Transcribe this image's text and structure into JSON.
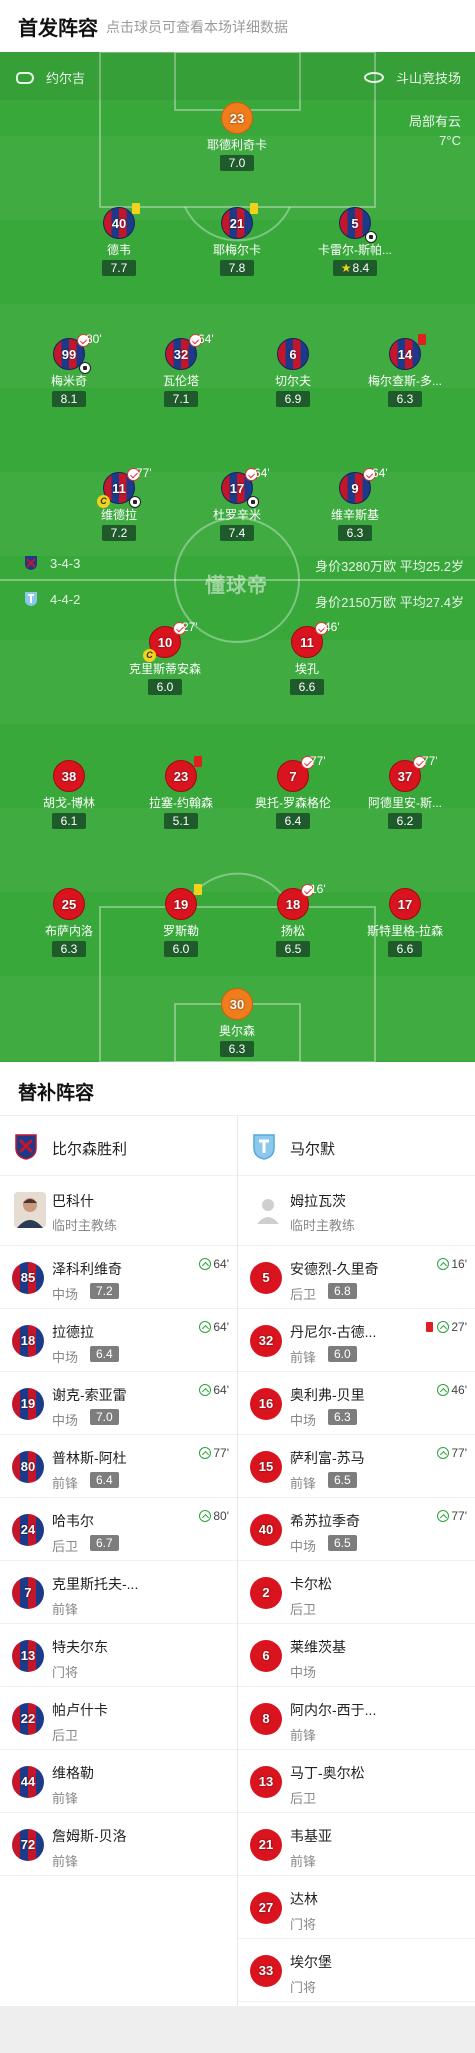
{
  "header": {
    "title": "首发阵容",
    "subtitle": "点击球员可查看本场详细数据"
  },
  "pitch": {
    "home_team_top": "约尔吉",
    "venue": "斗山竞技场",
    "weather": "局部有云",
    "temperature": "7°C",
    "watermark": "懂球帝",
    "home_formation": {
      "formation": "3-4-3",
      "stats": "身价3280万欧 平均25.2岁"
    },
    "away_formation": {
      "formation": "4-4-2",
      "stats": "身价2150万欧 平均27.4岁"
    },
    "players": [
      {
        "id": "p1",
        "num": "23",
        "name": "耶德利奇卡",
        "rating": "7.0",
        "kit": "gk"
      },
      {
        "id": "p2",
        "num": "40",
        "name": "德韦",
        "rating": "7.7",
        "kit": "home",
        "card": "yellow"
      },
      {
        "id": "p3",
        "num": "21",
        "name": "耶梅尔卡",
        "rating": "7.8",
        "kit": "home",
        "card": "yellow"
      },
      {
        "id": "p4",
        "num": "5",
        "name": "卡雷尔-斯帕...",
        "rating": "8.4",
        "kit": "home",
        "ball": true,
        "star": true
      },
      {
        "id": "p5",
        "num": "99",
        "name": "梅米奇",
        "rating": "8.1",
        "kit": "home",
        "sub": "80'",
        "ball": true
      },
      {
        "id": "p6",
        "num": "32",
        "name": "瓦伦塔",
        "rating": "7.1",
        "kit": "home",
        "sub": "64'"
      },
      {
        "id": "p7",
        "num": "6",
        "name": "切尔夫",
        "rating": "6.9",
        "kit": "home"
      },
      {
        "id": "p8",
        "num": "14",
        "name": "梅尔查斯-多...",
        "rating": "6.3",
        "kit": "home",
        "card": "red"
      },
      {
        "id": "p9",
        "num": "11",
        "name": "维德拉",
        "rating": "7.2",
        "kit": "home",
        "sub": "77'",
        "ball": true,
        "captain": true
      },
      {
        "id": "p10",
        "num": "17",
        "name": "杜罗辛米",
        "rating": "7.4",
        "kit": "home",
        "sub": "64'",
        "ball": true
      },
      {
        "id": "p11",
        "num": "9",
        "name": "维辛斯基",
        "rating": "6.3",
        "kit": "home",
        "sub": "64'"
      },
      {
        "id": "p12",
        "num": "10",
        "name": "克里斯蒂安森",
        "rating": "6.0",
        "kit": "away",
        "sub": "27'",
        "card": "yellow",
        "captain": true
      },
      {
        "id": "p13",
        "num": "11",
        "name": "埃孔",
        "rating": "6.6",
        "kit": "away",
        "sub": "46'"
      },
      {
        "id": "p14",
        "num": "38",
        "name": "胡戈-博林",
        "rating": "6.1",
        "kit": "away"
      },
      {
        "id": "p15",
        "num": "23",
        "name": "拉塞-约翰森",
        "rating": "5.1",
        "kit": "away",
        "card": "red"
      },
      {
        "id": "p16",
        "num": "7",
        "name": "奥托-罗森格伦",
        "rating": "6.4",
        "kit": "away",
        "sub": "77'"
      },
      {
        "id": "p17",
        "num": "37",
        "name": "阿德里安-斯...",
        "rating": "6.2",
        "kit": "away",
        "sub": "77'"
      },
      {
        "id": "p18",
        "num": "25",
        "name": "布萨内洛",
        "rating": "6.3",
        "kit": "away"
      },
      {
        "id": "p19",
        "num": "19",
        "name": "罗斯勒",
        "rating": "6.0",
        "kit": "away",
        "card": "yellow"
      },
      {
        "id": "p20",
        "num": "18",
        "name": "扬松",
        "rating": "6.5",
        "kit": "away",
        "sub": "16'"
      },
      {
        "id": "p21",
        "num": "17",
        "name": "斯特里格-拉森",
        "rating": "6.6",
        "kit": "away"
      },
      {
        "id": "p22",
        "num": "30",
        "name": "奥尔森",
        "rating": "6.3",
        "kit": "gk"
      }
    ]
  },
  "subs": {
    "title": "替补阵容",
    "home": {
      "team": "比尔森胜利",
      "coach": {
        "name": "巴科什",
        "role": "临时主教练"
      },
      "players": [
        {
          "num": "85",
          "name": "泽科利维奇",
          "pos": "中场",
          "rating": "7.2",
          "in": "64'"
        },
        {
          "num": "18",
          "name": "拉德拉",
          "pos": "中场",
          "rating": "6.4",
          "in": "64'"
        },
        {
          "num": "19",
          "name": "谢克-索亚雷",
          "pos": "中场",
          "rating": "7.0",
          "in": "64'"
        },
        {
          "num": "80",
          "name": "普林斯-阿杜",
          "pos": "前锋",
          "rating": "6.4",
          "in": "77'"
        },
        {
          "num": "24",
          "name": "哈韦尔",
          "pos": "后卫",
          "rating": "6.7",
          "in": "80'"
        },
        {
          "num": "7",
          "name": "克里斯托夫-...",
          "pos": "前锋"
        },
        {
          "num": "13",
          "name": "特夫尔东",
          "pos": "门将"
        },
        {
          "num": "22",
          "name": "帕卢什卡",
          "pos": "后卫"
        },
        {
          "num": "44",
          "name": "维格勒",
          "pos": "前锋"
        },
        {
          "num": "72",
          "name": "詹姆斯-贝洛",
          "pos": "前锋"
        }
      ]
    },
    "away": {
      "team": "马尔默",
      "coach": {
        "name": "姆拉瓦茨",
        "role": "临时主教练"
      },
      "players": [
        {
          "num": "5",
          "name": "安德烈-久里奇",
          "pos": "后卫",
          "rating": "6.8",
          "in": "16'"
        },
        {
          "num": "32",
          "name": "丹尼尔-古德...",
          "pos": "前锋",
          "rating": "6.0",
          "in": "27'",
          "red": true
        },
        {
          "num": "16",
          "name": "奥利弗-贝里",
          "pos": "中场",
          "rating": "6.3",
          "in": "46'"
        },
        {
          "num": "15",
          "name": "萨利富-苏马",
          "pos": "前锋",
          "rating": "6.5",
          "in": "77'"
        },
        {
          "num": "40",
          "name": "希苏拉季奇",
          "pos": "中场",
          "rating": "6.5",
          "in": "77'"
        },
        {
          "num": "2",
          "name": "卡尔松",
          "pos": "后卫"
        },
        {
          "num": "6",
          "name": "莱维茨基",
          "pos": "中场"
        },
        {
          "num": "8",
          "name": "阿内尔-西于...",
          "pos": "前锋"
        },
        {
          "num": "13",
          "name": "马丁-奥尔松",
          "pos": "后卫"
        },
        {
          "num": "21",
          "name": "韦基亚",
          "pos": "前锋"
        },
        {
          "num": "27",
          "name": "达林",
          "pos": "门将"
        },
        {
          "num": "33",
          "name": "埃尔堡",
          "pos": "门将"
        }
      ]
    }
  },
  "colors": {
    "pitch": "#39a83b",
    "home_red": "#c4162a",
    "home_blue": "#1d3a8a",
    "away_red": "#d9141f",
    "gk_orange": "#f07c1c",
    "rating_bg": "#1f5a2a"
  }
}
